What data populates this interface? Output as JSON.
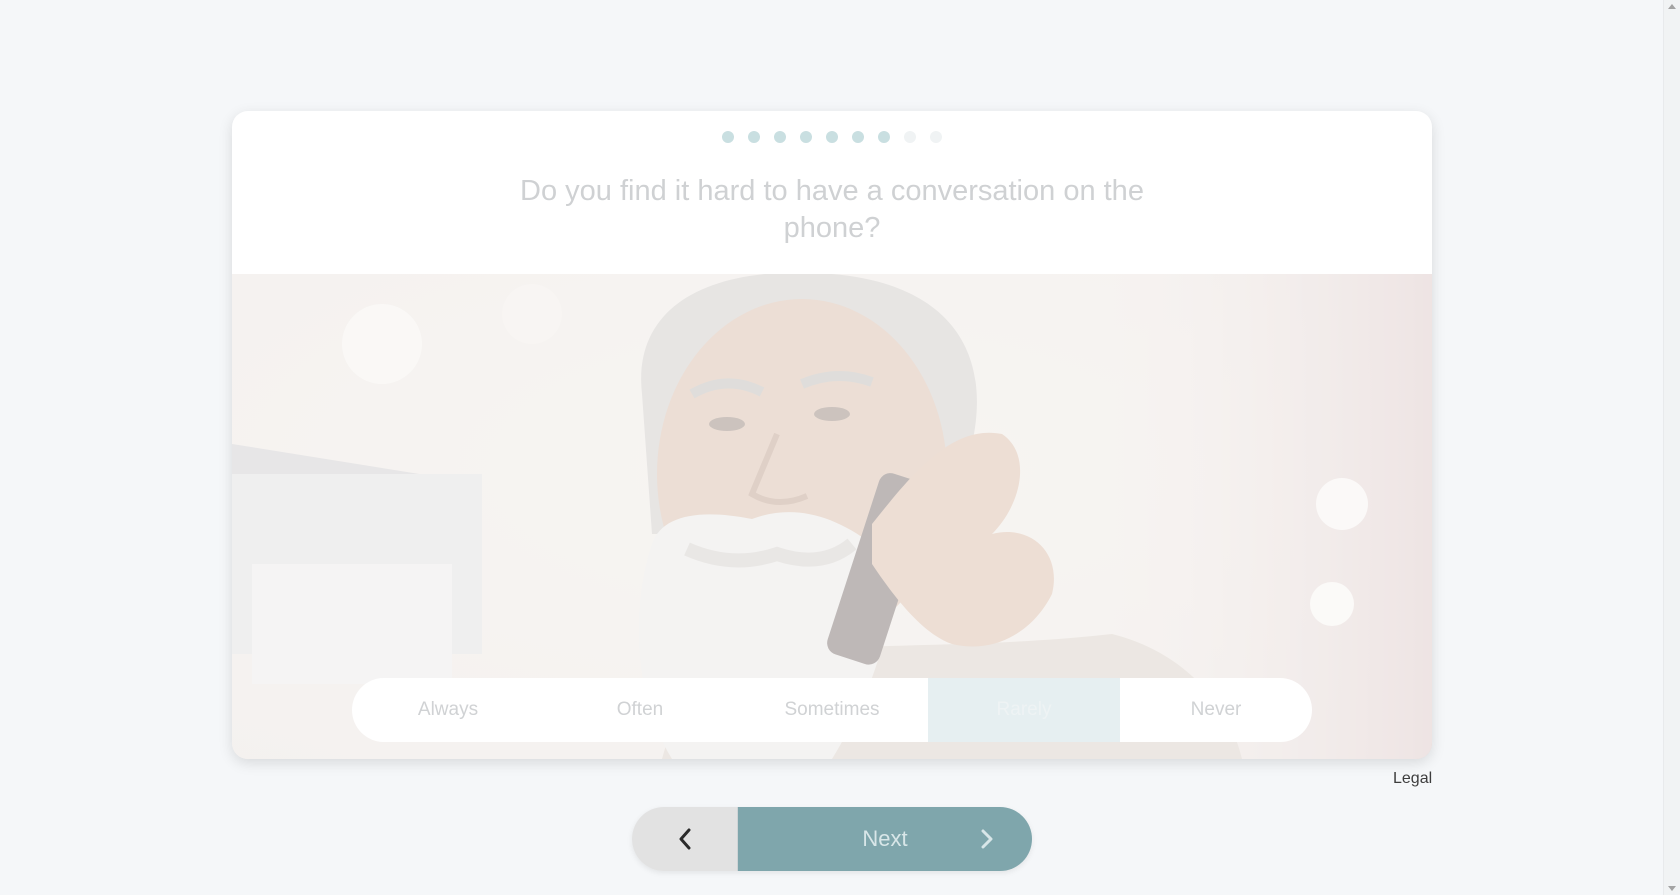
{
  "progress": {
    "total_steps": 9,
    "completed_steps": 7
  },
  "question": {
    "text": "Do you find it hard to have a conversation on the phone?"
  },
  "photo": {
    "description": "older-man-with-beard-on-phone"
  },
  "options": [
    {
      "label": "Always",
      "selected": false
    },
    {
      "label": "Often",
      "selected": false
    },
    {
      "label": "Sometimes",
      "selected": false
    },
    {
      "label": "Rarely",
      "selected": true
    },
    {
      "label": "Never",
      "selected": false
    }
  ],
  "footer": {
    "legal_label": "Legal"
  },
  "navigation": {
    "back_icon": "chevron-left-icon",
    "next_label": "Next",
    "next_icon": "chevron-right-icon"
  },
  "colors": {
    "accent": "#7fa6ac",
    "dot_done": "#c9dfe1",
    "dot_pending": "#f0f3f4",
    "selected_option_bg": "#e6eff1",
    "page_bg": "#f5f7f9"
  }
}
